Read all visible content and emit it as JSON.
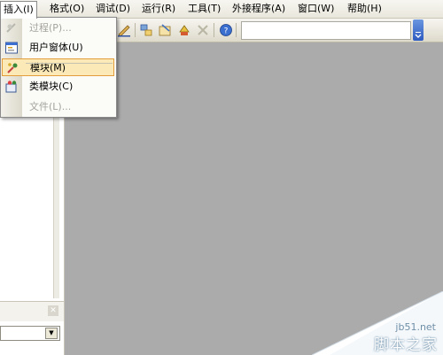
{
  "menubar": {
    "items": [
      {
        "label": "插入(I)"
      },
      {
        "label": "格式(O)"
      },
      {
        "label": "调试(D)"
      },
      {
        "label": "运行(R)"
      },
      {
        "label": "工具(T)"
      },
      {
        "label": "外接程序(A)"
      },
      {
        "label": "窗口(W)"
      },
      {
        "label": "帮助(H)"
      }
    ]
  },
  "insert_menu": {
    "items": [
      {
        "label": "过程(P)...",
        "icon": "procedure-icon",
        "enabled": false
      },
      {
        "label": "用户窗体(U)",
        "icon": "userform-icon",
        "enabled": true
      },
      {
        "label": "模块(M)",
        "icon": "module-icon",
        "enabled": true,
        "highlighted": true
      },
      {
        "label": "类模块(C)",
        "icon": "class-module-icon",
        "enabled": true
      },
      {
        "label": "文件(L)...",
        "icon": "file-icon",
        "enabled": false
      }
    ]
  },
  "colors": {
    "workspace": "#ababab",
    "highlight_fill": "#fbe9b7",
    "highlight_border": "#e39d3a",
    "toolbar_chevron": "#2e5bc0"
  },
  "watermark": {
    "site": "jb51.net",
    "brand": "脚本之家"
  }
}
